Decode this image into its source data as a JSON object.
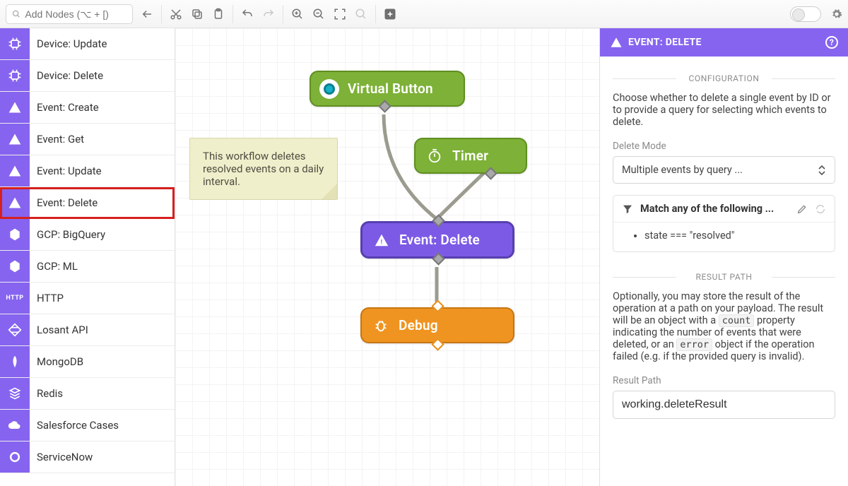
{
  "toolbar": {
    "search_placeholder": "Add Nodes (⌥ + [)"
  },
  "palette": [
    {
      "label": "Device: Update",
      "icon": "chip"
    },
    {
      "label": "Device: Delete",
      "icon": "chip"
    },
    {
      "label": "Event: Create",
      "icon": "triangle"
    },
    {
      "label": "Event: Get",
      "icon": "triangle"
    },
    {
      "label": "Event: Update",
      "icon": "triangle"
    },
    {
      "label": "Event: Delete",
      "icon": "triangle",
      "highlight": true
    },
    {
      "label": "GCP: BigQuery",
      "icon": "hex"
    },
    {
      "label": "GCP: ML",
      "icon": "hex"
    },
    {
      "label": "HTTP",
      "icon": "http"
    },
    {
      "label": "Losant API",
      "icon": "diamond"
    },
    {
      "label": "MongoDB",
      "icon": "leaf"
    },
    {
      "label": "Redis",
      "icon": "stack"
    },
    {
      "label": "Salesforce Cases",
      "icon": "cloud"
    },
    {
      "label": "ServiceNow",
      "icon": "circle"
    }
  ],
  "canvas": {
    "note_text": "This workflow deletes resolved events on a daily interval.",
    "nodes": {
      "virtual_button": "Virtual Button",
      "timer": "Timer",
      "event_delete": "Event: Delete",
      "debug": "Debug"
    }
  },
  "side": {
    "title": "EVENT: DELETE",
    "section_config": "CONFIGURATION",
    "config_desc": "Choose whether to delete a single event by ID or to provide a query for selecting which events to delete.",
    "delete_mode_label": "Delete Mode",
    "delete_mode_value": "Multiple events by query ...",
    "rule_header": "Match any of the following ...",
    "rule_item": "state === \"resolved\"",
    "section_result": "RESULT PATH",
    "result_desc_1": "Optionally, you may store the result of the operation at a path on your payload. The result will be an object with a ",
    "result_code_1": "count",
    "result_desc_2": " property indicating the number of events that were deleted, or an ",
    "result_code_2": "error",
    "result_desc_3": " object if the operation failed (e.g. if the provided query is invalid).",
    "result_path_label": "Result Path",
    "result_path_value": "working.deleteResult"
  },
  "colors": {
    "brand": "#8664ef",
    "node_green": "#7db137",
    "node_orange": "#ef9420"
  }
}
